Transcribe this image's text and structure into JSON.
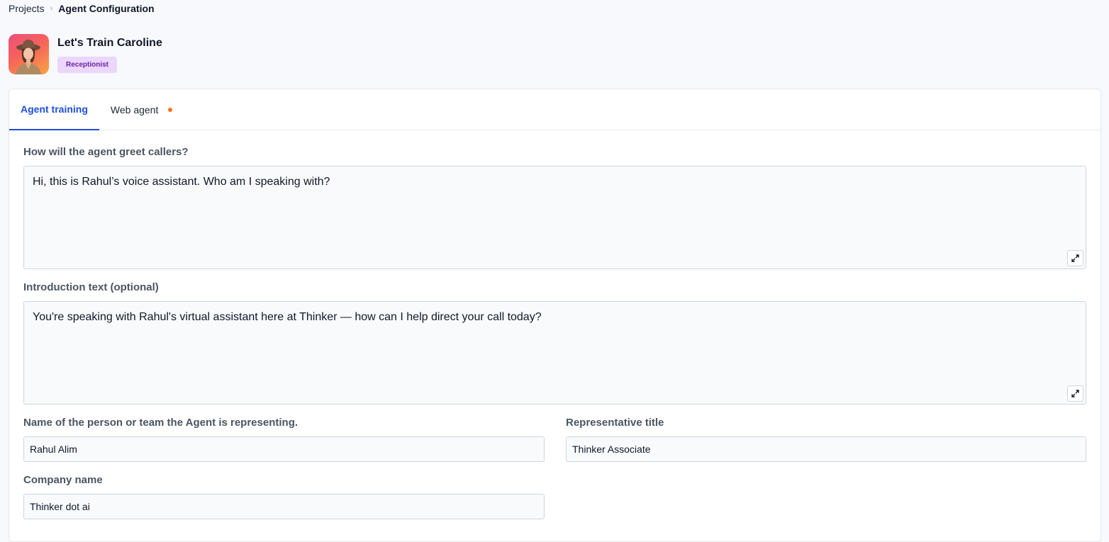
{
  "breadcrumb": {
    "parent": "Projects",
    "separator": "›",
    "current": "Agent Configuration"
  },
  "agent": {
    "title": "Let's Train Caroline",
    "role": "Receptionist",
    "avatar_icon": "woman-portrait-avatar"
  },
  "tabs": [
    {
      "label": "Agent training",
      "active": true
    },
    {
      "label": "Web agent",
      "active": false,
      "indicator_color": "#f97316"
    }
  ],
  "form": {
    "greeting": {
      "label": "How will the agent greet callers?",
      "value": "Hi, this is Rahul’s voice assistant. Who am I speaking with?"
    },
    "introduction": {
      "label": "Introduction text (optional)",
      "value": "You're speaking with Rahul's virtual assistant here at Thinker — how can I help direct your call today?"
    },
    "representing": {
      "label": "Name of the person or team the Agent is representing.",
      "value": "Rahul Alim"
    },
    "rep_title": {
      "label": "Representative title",
      "value": "Thinker Associate"
    },
    "company": {
      "label": "Company name",
      "value": "Thinker dot ai"
    }
  },
  "colors": {
    "accent": "#1d4ed8",
    "badge_bg": "#ead7fb",
    "badge_text": "#6b21a8",
    "tab_dot": "#f97316"
  }
}
